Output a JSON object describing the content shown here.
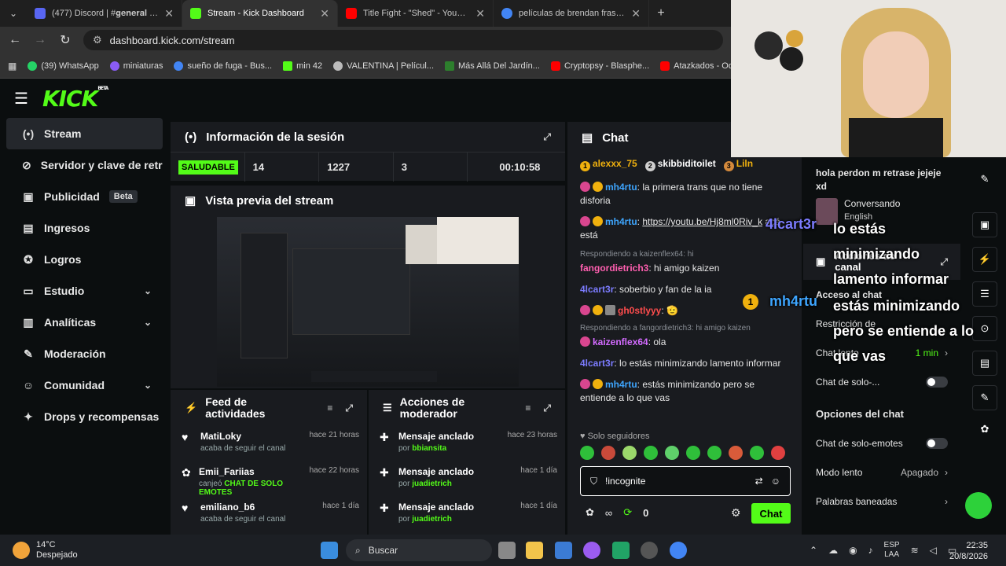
{
  "browser": {
    "tabs": [
      {
        "title": "(477) Discord | #𝐠𝐞𝐧𝐞𝐫𝐚𝐥 | EMO...",
        "color": "#5865f2"
      },
      {
        "title": "Stream - Kick Dashboard",
        "color": "#53fc18"
      },
      {
        "title": "Title Fight - \"Shed\" - YouTube",
        "color": "#ff0000"
      },
      {
        "title": "películas de brendan fraser - Bu...",
        "color": "#4285f4"
      }
    ],
    "url": "dashboard.kick.com/stream",
    "bookmarks": [
      {
        "label": "(39) WhatsApp",
        "color": "#25d366"
      },
      {
        "label": "miniaturas",
        "color": "#8a5cf6"
      },
      {
        "label": "sueño de fuga - Bus...",
        "color": "#4285f4"
      },
      {
        "label": "min 42",
        "color": "#53fc18"
      },
      {
        "label": "VALENTINA | Películ...",
        "color": "#bbbbbb"
      },
      {
        "label": "Más Allá Del Jardín...",
        "color": "#2d7f2d"
      },
      {
        "label": "Cryptopsy - Blasphe...",
        "color": "#ff0000"
      },
      {
        "label": "Atazkados - Odio La...",
        "color": "#ff0000"
      }
    ]
  },
  "kick": {
    "logo": "KICK",
    "logo_sup": "BETA",
    "sidebar": [
      {
        "label": "Stream",
        "icon": "(•)",
        "active": true
      },
      {
        "label": "Servidor y clave de retransmisión",
        "icon": "⊘"
      },
      {
        "label": "Publicidad",
        "icon": "▣",
        "badge": "Beta"
      },
      {
        "label": "Ingresos",
        "icon": "▤"
      },
      {
        "label": "Logros",
        "icon": "✪"
      },
      {
        "label": "Estudio",
        "icon": "▭",
        "chev": "⌄"
      },
      {
        "label": "Analíticas",
        "icon": "▥",
        "chev": "⌄"
      },
      {
        "label": "Moderación",
        "icon": "✎"
      },
      {
        "label": "Comunidad",
        "icon": "☺",
        "chev": "⌄"
      },
      {
        "label": "Drops y recompensas",
        "icon": "✦"
      }
    ]
  },
  "session": {
    "title": "Información de la sesión",
    "status": "SALUDABLE",
    "stat2": "14",
    "stat3": "1227",
    "stat4": "3",
    "stat5": "00:10:58"
  },
  "preview": {
    "title": "Vista previa del stream"
  },
  "feed": {
    "title_line1": "Feed de",
    "title_line2": "actividades",
    "items": [
      {
        "name": "MatiLoky",
        "time": "hace 21 horas",
        "sub": "acaba de seguir el canal",
        "icon": "♥",
        "highlight": ""
      },
      {
        "name": "Emii_Fariias",
        "time": "hace 22 horas",
        "sub": "canjeó ",
        "icon": "✿",
        "highlight": "CHAT DE SOLO EMOTES"
      },
      {
        "name": "emiliano_b6",
        "time": "hace 1 día",
        "sub": "acaba de seguir el canal",
        "icon": "♥",
        "highlight": ""
      }
    ]
  },
  "modact": {
    "title_line1": "Acciones de",
    "title_line2": "moderador",
    "items": [
      {
        "name": "Mensaje anclado",
        "time": "hace 23 horas",
        "by": "por ",
        "user": "bbiansita"
      },
      {
        "name": "Mensaje anclado",
        "time": "hace 1 día",
        "by": "por ",
        "user": "juadietrich"
      },
      {
        "name": "Mensaje anclado",
        "time": "hace 1 día",
        "by": "por ",
        "user": "juadietrich"
      }
    ]
  },
  "chat": {
    "title": "Chat",
    "top_users": [
      {
        "name": "alexxx_75",
        "rank": "1",
        "color": "#f0b10e"
      },
      {
        "name": "skibbiditoilet",
        "rank": "2",
        "color": "#cfcfcf"
      },
      {
        "name": "Liln",
        "rank": "3",
        "color": "#d48a3c"
      }
    ],
    "messages": [
      {
        "type": "msg",
        "user": "mh4rtu",
        "color": "#3ea6ff",
        "text": ": la primera trans que no tiene disforia",
        "badges": [
          "pink",
          "gold"
        ]
      },
      {
        "type": "msg",
        "user": "mh4rtu",
        "color": "#3ea6ff",
        "text": ": ",
        "link": "https://youtu.be/Hj8ml0Riv_k",
        "text2": " acá está",
        "badges": [
          "pink",
          "gold"
        ]
      },
      {
        "type": "reply",
        "text": "Respondiendo a kaizenflex64: hi"
      },
      {
        "type": "msg",
        "user": "fangordietrich3",
        "color": "#ff5fb0",
        "text": ": hi amigo kaizen",
        "badges": []
      },
      {
        "type": "msg",
        "user": "4lcart3r",
        "color": "#7c7cff",
        "text": ": soberbio y fan de la ia",
        "badges": []
      },
      {
        "type": "msg",
        "user": "gh0stlyyy",
        "color": "#ff4d4d",
        "text": ": 🫡",
        "badges": [
          "pink",
          "gold",
          "grey"
        ]
      },
      {
        "type": "reply",
        "text": "Respondiendo a fangordietrich3: hi amigo kaizen"
      },
      {
        "type": "msg",
        "user": "kaizenflex64",
        "color": "#d36bff",
        "text": ": ola",
        "badges": [
          "pink"
        ]
      },
      {
        "type": "msg",
        "user": "4lcart3r",
        "color": "#7c7cff",
        "text": ": lo estás minimizando lamento informar",
        "badges": []
      },
      {
        "type": "msg",
        "user": "mh4rtu",
        "color": "#3ea6ff",
        "text": ": estás minimizando pero se entiende a lo que vas",
        "badges": [
          "pink",
          "gold"
        ]
      }
    ],
    "followers_only": "Solo seguidores",
    "input_value": "!incognite",
    "send_label": "Chat",
    "points": "0"
  },
  "right": {
    "pinned_text": "hola perdon m retrase jejeje xd",
    "conversando": "Conversando",
    "english": "English",
    "actions_title": "Acciones de canal",
    "access_chat": "Acceso al chat",
    "restrict": "Restricción de",
    "chat_lento": "Chat lento",
    "chat_lento_val": "1 min",
    "chat_solo": "Chat de solo-...",
    "options_title": "Opciones del chat",
    "solo_emotes": "Chat de solo-emotes",
    "modo_lento": "Modo lento",
    "modo_lento_val": "Apagado",
    "palabras": "Palabras baneadas"
  },
  "overlay": {
    "user1": "4lcart3r",
    "line1a": "lo estás",
    "line1b": "minimizando",
    "line1c": "lamento informar",
    "user2": "mh4rtu",
    "line2a": "estás minimizando",
    "line2b": "pero se entiende a lo",
    "line2c": "que vas"
  },
  "taskbar": {
    "temp": "14°C",
    "weather": "Despejado",
    "search": "Buscar",
    "lang1": "ESP",
    "lang2": "LAA",
    "time": "22:35",
    "date": "20/8/2026"
  }
}
